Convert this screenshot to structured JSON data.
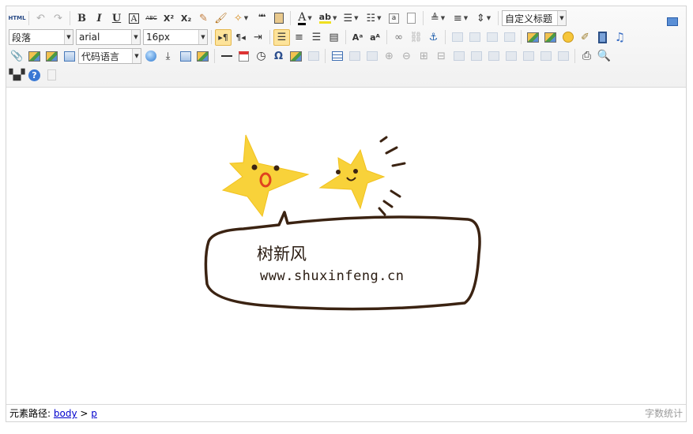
{
  "toolbar": {
    "row1": {
      "source_label": "HTML",
      "bold": "B",
      "italic": "I",
      "underline": "U",
      "fontborder": "A",
      "strike": "ABC",
      "superscript": "X²",
      "subscript": "X₂",
      "blockquote": "❝❝",
      "forecolor": "A",
      "custom_title": "自定义标题"
    },
    "row2": {
      "paragraph": "段落",
      "fontfamily": "arial",
      "fontsize": "16px"
    },
    "row3": {
      "code_language": "代码语言",
      "special_char": "Ω"
    }
  },
  "content": {
    "image_text": "树新风",
    "image_url": "www.shuxinfeng.cn"
  },
  "statusbar": {
    "path_label": "元素路径:",
    "path_body": "body",
    "path_sep": ">",
    "path_p": "p",
    "word_count": "字数统计"
  },
  "colors": {
    "star": "#f8d23a",
    "bubble_stroke": "#3b2312",
    "active_button": "#fde39a"
  }
}
